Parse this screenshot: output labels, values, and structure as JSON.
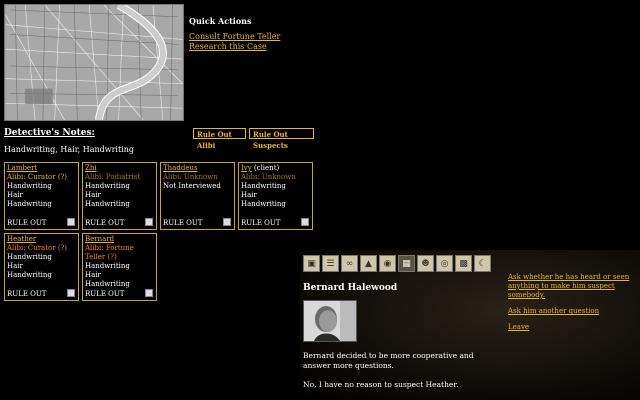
{
  "quick_actions": {
    "title": "Quick Actions",
    "links": [
      "Consult Fortune Teller",
      "Research this Case"
    ]
  },
  "notes": {
    "title": "Detective's Notes:",
    "rule_out_alibi": "Rule Out Alibi",
    "rule_out_suspects": "Rule Out Suspects",
    "clues": "Handwriting, Hair, Handwriting"
  },
  "suspects": [
    {
      "name": "Lambert",
      "client": "",
      "alibi": "Alibi: Curator (?)",
      "alibi_style": "strong",
      "clues": [
        "Handwriting",
        "Hair",
        "Handwriting"
      ],
      "rule": "RULE OUT"
    },
    {
      "name": "Zhi",
      "client": "",
      "alibi": "Alibi: Podiatrist",
      "alibi_style": "dim",
      "clues": [
        "Handwriting",
        "Hair",
        "Handwriting"
      ],
      "rule": "RULE OUT"
    },
    {
      "name": "Thaddeus",
      "client": "",
      "alibi": "Alibi: Unknown",
      "alibi_style": "dim",
      "clues": [
        "Not Interviewed"
      ],
      "rule": "RULE OUT"
    },
    {
      "name": "Ivy",
      "client": " (client)",
      "alibi": "Alibi: Unknown",
      "alibi_style": "dim",
      "clues": [
        "Handwriting",
        "Hair",
        "Handwriting"
      ],
      "rule": "RULE OUT"
    },
    {
      "name": "Heather",
      "client": "",
      "alibi": "Alibi: Curator (?)",
      "alibi_style": "orange",
      "clues": [
        "Handwriting",
        "Hair",
        "Handwriting"
      ],
      "rule": "RULE OUT"
    },
    {
      "name": "Bernard",
      "client": "",
      "alibi": "Alibi: Fortune Teller (?)",
      "alibi_style": "orange",
      "clues": [
        "Handwriting",
        "Hair",
        "Handwriting"
      ],
      "rule": "RULE OUT"
    }
  ],
  "toolbar": {
    "icons": [
      "door-icon",
      "ladder-icon",
      "handcuffs-icon",
      "hat-icon",
      "kettle-icon",
      "book-icon",
      "person-icon",
      "globe-icon",
      "camera-icon",
      "moon-icon"
    ],
    "selected_index": 5
  },
  "dialog": {
    "speaker": "Bernard Halewood",
    "line1": "Bernard decided to be more cooperative and answer more questions.",
    "line2": "No, I have no reason to suspect Heather.",
    "options": [
      "Ask whether he has heard or seen anything to make him suspect somebody.",
      "Ask him another question",
      "Leave"
    ]
  }
}
